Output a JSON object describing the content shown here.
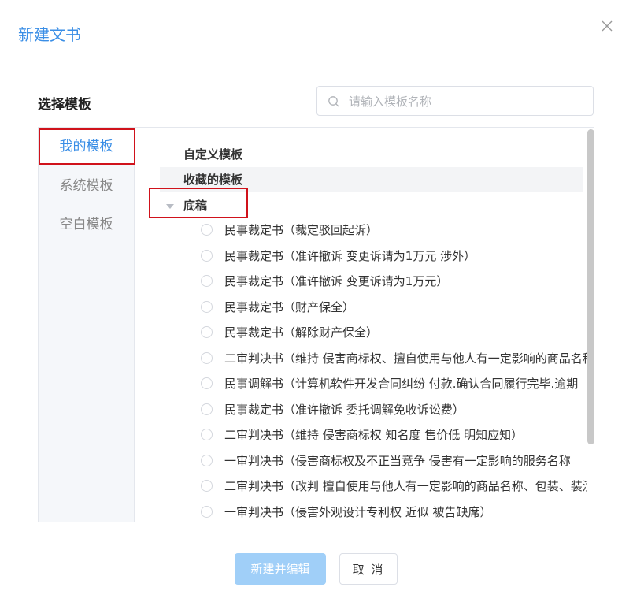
{
  "dialog": {
    "title": "新建文书",
    "section_label": "选择模板",
    "search_placeholder": "请输入模板名称"
  },
  "sidebar": {
    "items": [
      {
        "label": "我的模板",
        "active": true
      },
      {
        "label": "系统模板",
        "active": false
      },
      {
        "label": "空白模板",
        "active": false
      }
    ]
  },
  "tree": {
    "groups": [
      {
        "label": "自定义模板"
      },
      {
        "label": "收藏的模板"
      },
      {
        "label": "底稿",
        "expanded": true
      }
    ],
    "templates": [
      "民事裁定书（裁定驳回起诉）",
      "民事裁定书（准许撤诉 变更诉请为1万元 涉外）",
      "民事裁定书（准许撤诉 变更诉请为1万元）",
      "民事裁定书（财产保全）",
      "民事裁定书（解除财产保全）",
      "二审判决书（维持 侵害商标权、擅自使用与他人有一定影响的商品名称",
      "民事调解书（计算机软件开发合同纠纷 付款.确认合同履行完毕.逾期",
      "民事裁定书（准许撤诉 委托调解免收诉讼费）",
      "二审判决书（维持 侵害商标权 知名度 售价低 明知应知）",
      "一审判决书（侵害商标权及不正当竞争 侵害有一定影响的服务名称",
      "二审判决书（改判 擅自使用与他人有一定影响的商品名称、包装、装潢",
      "一审判决书（侵害外观设计专利权 近似 被告缺席）"
    ]
  },
  "footer": {
    "primary_label": "新建并编辑",
    "cancel_label": "取 消"
  },
  "colors": {
    "accent": "#3a8ee6",
    "primary_disabled": "#a0cff8",
    "highlight_box": "#d0121b"
  }
}
